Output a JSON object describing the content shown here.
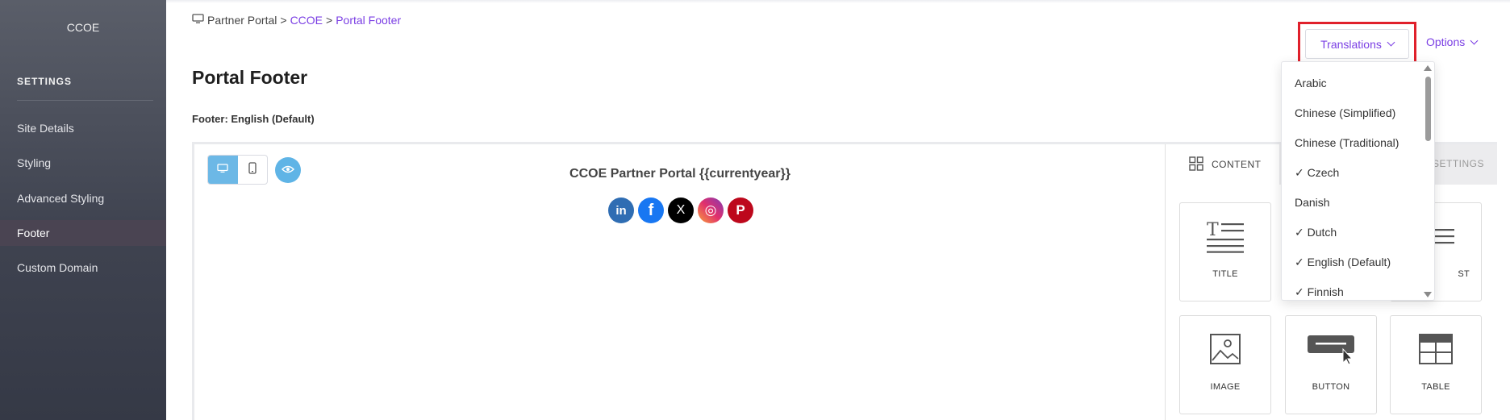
{
  "sidebar": {
    "brand": "CCOE",
    "section": "SETTINGS",
    "items": [
      {
        "label": "Site Details"
      },
      {
        "label": "Styling"
      },
      {
        "label": "Advanced Styling"
      },
      {
        "label": "Footer",
        "active": true
      },
      {
        "label": "Custom Domain"
      }
    ]
  },
  "breadcrumb": {
    "root": "Partner Portal",
    "sep": ">",
    "middle": "CCOE",
    "current": "Portal Footer"
  },
  "page": {
    "title": "Portal Footer",
    "footer_label": "Footer: English (Default)"
  },
  "header": {
    "translations_label": "Translations",
    "options_label": "Options"
  },
  "canvas": {
    "footer_text": "CCOE Partner Portal {{currentyear}}",
    "socials": [
      {
        "name": "linkedin",
        "glyph": "in",
        "color": "#2f6db3"
      },
      {
        "name": "facebook",
        "glyph": "f",
        "color": "#1877f2"
      },
      {
        "name": "x",
        "glyph": "X",
        "color": "#000000"
      },
      {
        "name": "instagram",
        "glyph": "◎",
        "color": "#c13584"
      },
      {
        "name": "pinterest",
        "glyph": "P",
        "color": "#bd081c"
      }
    ]
  },
  "panel": {
    "tab_content": "CONTENT",
    "tab_settings": "SETTINGS",
    "tiles": [
      {
        "label": "TITLE",
        "icon": "title-icon"
      },
      {
        "label": "ST",
        "icon": "list-icon"
      },
      {
        "label": "IMAGE",
        "icon": "image-icon"
      },
      {
        "label": "BUTTON",
        "icon": "button-icon"
      },
      {
        "label": "TABLE",
        "icon": "table-icon"
      }
    ]
  },
  "translations_menu": {
    "items": [
      {
        "label": "Arabic"
      },
      {
        "label": "Chinese (Simplified)"
      },
      {
        "label": "Chinese (Traditional)"
      },
      {
        "label": "✓ Czech"
      },
      {
        "label": "Danish"
      },
      {
        "label": "✓ Dutch"
      },
      {
        "label": "✓ English (Default)"
      },
      {
        "label": "✓ Finnish"
      }
    ]
  },
  "colors": {
    "accent": "#7b3fe4",
    "highlight_border": "#e0202b",
    "toggle_active": "#6cb8e6"
  }
}
